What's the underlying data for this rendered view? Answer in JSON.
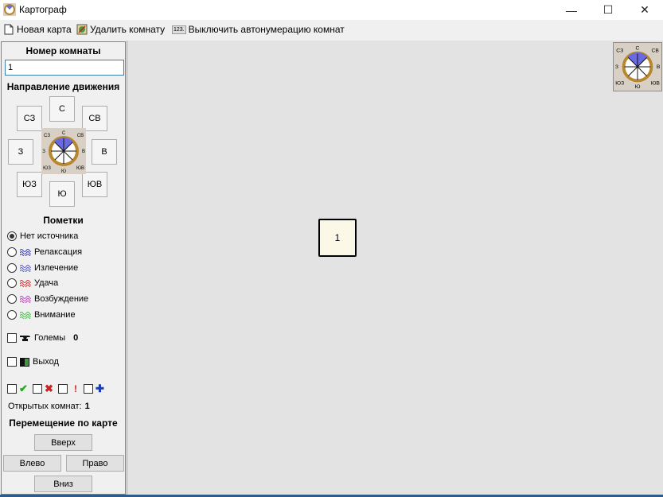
{
  "window": {
    "title": "Картограф",
    "controls": {
      "minimize": "—",
      "maximize": "☐",
      "close": "✕"
    }
  },
  "toolbar": {
    "new_map": "Новая карта",
    "delete_room": "Удалить комнату",
    "toggle_autonumber": "Выключить автонумерацию комнат",
    "toggle_autonumber_icon_text": "123."
  },
  "sidebar": {
    "room_number_title": "Номер комнаты",
    "room_number_value": "1",
    "direction_title": "Направление движения",
    "directions": {
      "nw": "СЗ",
      "n": "С",
      "ne": "СВ",
      "w": "З",
      "e": "В",
      "sw": "ЮЗ",
      "s": "Ю",
      "se": "ЮВ"
    },
    "compass_labels": {
      "n": "С",
      "ne": "СВ",
      "nw": "СЗ",
      "w": "З",
      "e": "В",
      "sw": "ЮЗ",
      "s": "Ю",
      "se": "ЮВ"
    },
    "marks_title": "Пометки",
    "marks": [
      {
        "label": "Нет источника",
        "selected": true,
        "color": ""
      },
      {
        "label": "Релаксация",
        "selected": false,
        "color": "#3a3ab8"
      },
      {
        "label": "Излечение",
        "selected": false,
        "color": "#5a5ac8"
      },
      {
        "label": "Удача",
        "selected": false,
        "color": "#d03030"
      },
      {
        "label": "Возбуждение",
        "selected": false,
        "color": "#c040c0"
      },
      {
        "label": "Внимание",
        "selected": false,
        "color": "#40c040"
      }
    ],
    "golems_label": "Големы",
    "golems_count": "0",
    "exit_label": "Выход",
    "opened_rooms_label": "Открытых комнат:",
    "opened_rooms_count": "1",
    "nav_title": "Перемещение по карте",
    "nav_up": "Вверх",
    "nav_left": "Влево",
    "nav_right": "Право",
    "nav_down": "Вниз"
  },
  "map": {
    "rooms": [
      {
        "number": "1"
      }
    ]
  }
}
